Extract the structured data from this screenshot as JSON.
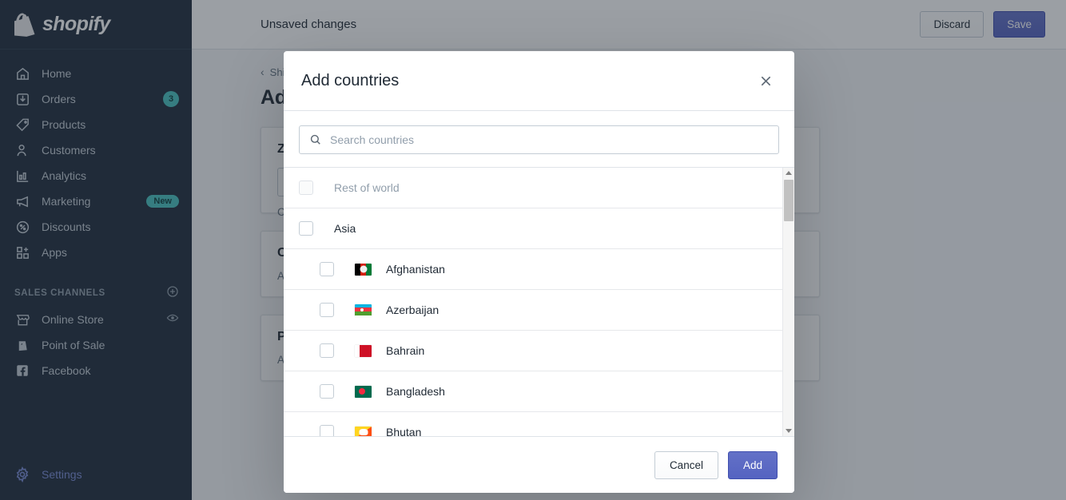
{
  "sidebar": {
    "logo_text": "shopify",
    "logo_icon": "shopify-bag-icon",
    "items": [
      {
        "label": "Home",
        "icon": "home-icon",
        "badge": null,
        "active": false
      },
      {
        "label": "Orders",
        "icon": "orders-inbox-icon",
        "badge": "3",
        "active": false
      },
      {
        "label": "Products",
        "icon": "products-tag-icon",
        "badge": null,
        "active": false
      },
      {
        "label": "Customers",
        "icon": "customers-person-icon",
        "badge": null,
        "active": false
      },
      {
        "label": "Analytics",
        "icon": "analytics-bar-chart-icon",
        "badge": null,
        "active": false
      },
      {
        "label": "Marketing",
        "icon": "marketing-megaphone-icon",
        "badge": "New",
        "active": false
      },
      {
        "label": "Discounts",
        "icon": "discounts-percent-icon",
        "badge": null,
        "active": false
      },
      {
        "label": "Apps",
        "icon": "apps-grid-plus-icon",
        "badge": null,
        "active": false
      }
    ],
    "section_title": "SALES CHANNELS",
    "section_add_icon": "plus-circle-icon",
    "channels": [
      {
        "label": "Online Store",
        "icon": "online-store-icon",
        "trailing_icon": "eye-icon"
      },
      {
        "label": "Point of Sale",
        "icon": "point-of-sale-icon",
        "trailing_icon": null
      },
      {
        "label": "Facebook",
        "icon": "facebook-icon",
        "trailing_icon": null
      }
    ],
    "settings": {
      "label": "Settings",
      "icon": "gear-icon"
    }
  },
  "topbar": {
    "title": "Unsaved changes",
    "discard_label": "Discard",
    "save_label": "Save"
  },
  "page": {
    "breadcrumb_icon": "chevron-left-icon",
    "breadcrumb_label": "Shipping",
    "title": "Add shipping zone",
    "cards": [
      {
        "title": "Zone name",
        "sub": "Customers in these countries will see the rates in this zone."
      },
      {
        "title": "Countries",
        "sub": "Add countries to this shipping zone."
      },
      {
        "title": "Price based rates",
        "sub": "Add rates for this zone."
      }
    ]
  },
  "modal": {
    "title": "Add countries",
    "close_icon": "close-x-icon",
    "search": {
      "icon": "search-icon",
      "placeholder": "Search countries",
      "value": ""
    },
    "rows": [
      {
        "type": "group",
        "label": "Rest of world",
        "checked": false,
        "disabled": true,
        "flag": null
      },
      {
        "type": "group",
        "label": "Asia",
        "checked": false,
        "disabled": false,
        "flag": null
      },
      {
        "type": "country",
        "label": "Afghanistan",
        "checked": false,
        "disabled": false,
        "flag": "f-af"
      },
      {
        "type": "country",
        "label": "Azerbaijan",
        "checked": false,
        "disabled": false,
        "flag": "f-az"
      },
      {
        "type": "country",
        "label": "Bahrain",
        "checked": false,
        "disabled": false,
        "flag": "f-bh"
      },
      {
        "type": "country",
        "label": "Bangladesh",
        "checked": false,
        "disabled": false,
        "flag": "f-bd"
      },
      {
        "type": "country",
        "label": "Bhutan",
        "checked": false,
        "disabled": false,
        "flag": "f-bt"
      }
    ],
    "scrollbar": {
      "up_icon": "scroll-up-arrow-icon",
      "down_icon": "scroll-down-arrow-icon"
    },
    "cancel_label": "Cancel",
    "add_label": "Add"
  },
  "colors": {
    "accent_indigo": "#5c6ac4",
    "badge_teal": "#47c1bf",
    "sidebar_bg": "#1f2d3d",
    "text_dark": "#212b36",
    "text_muted": "#637381"
  }
}
